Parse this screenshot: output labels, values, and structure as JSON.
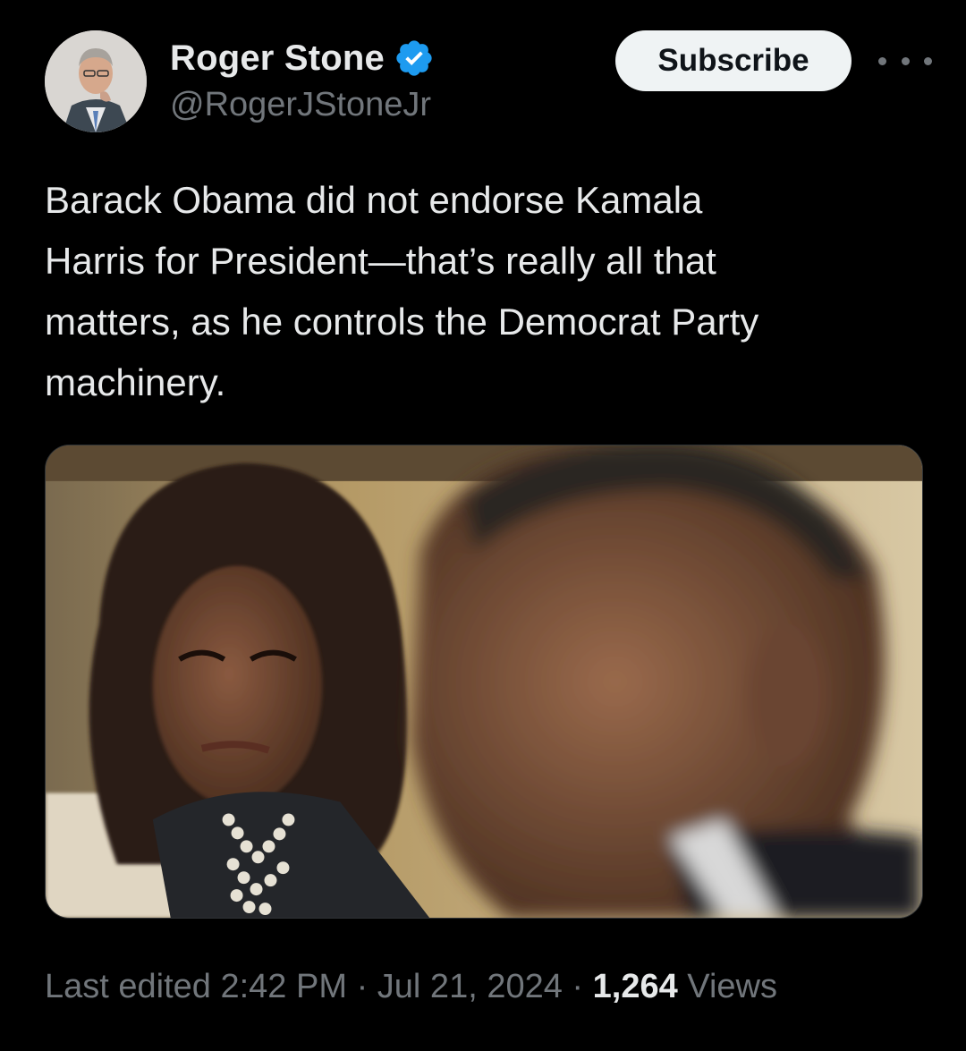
{
  "author": {
    "display_name": "Roger Stone",
    "handle": "@RogerJStoneJr",
    "verified": true,
    "avatar_icon": "avatar-photo"
  },
  "actions": {
    "subscribe_label": "Subscribe",
    "more_icon": "more-horizontal-icon"
  },
  "tweet": {
    "text": "Barack Obama did not endorse Kamala\nHarris for President—that’s really all that\nmatters, as he controls the Democrat Party\nmachinery."
  },
  "meta": {
    "edited_label": "Last edited",
    "time": "2:42 PM",
    "separator": "·",
    "date": "Jul 21, 2024",
    "views_count": "1,264",
    "views_label": "Views"
  },
  "colors": {
    "background": "#000000",
    "text_primary": "#e7e9ea",
    "text_secondary": "#71767b",
    "verified_blue": "#1d9bf0",
    "button_bg": "#eff3f4"
  }
}
